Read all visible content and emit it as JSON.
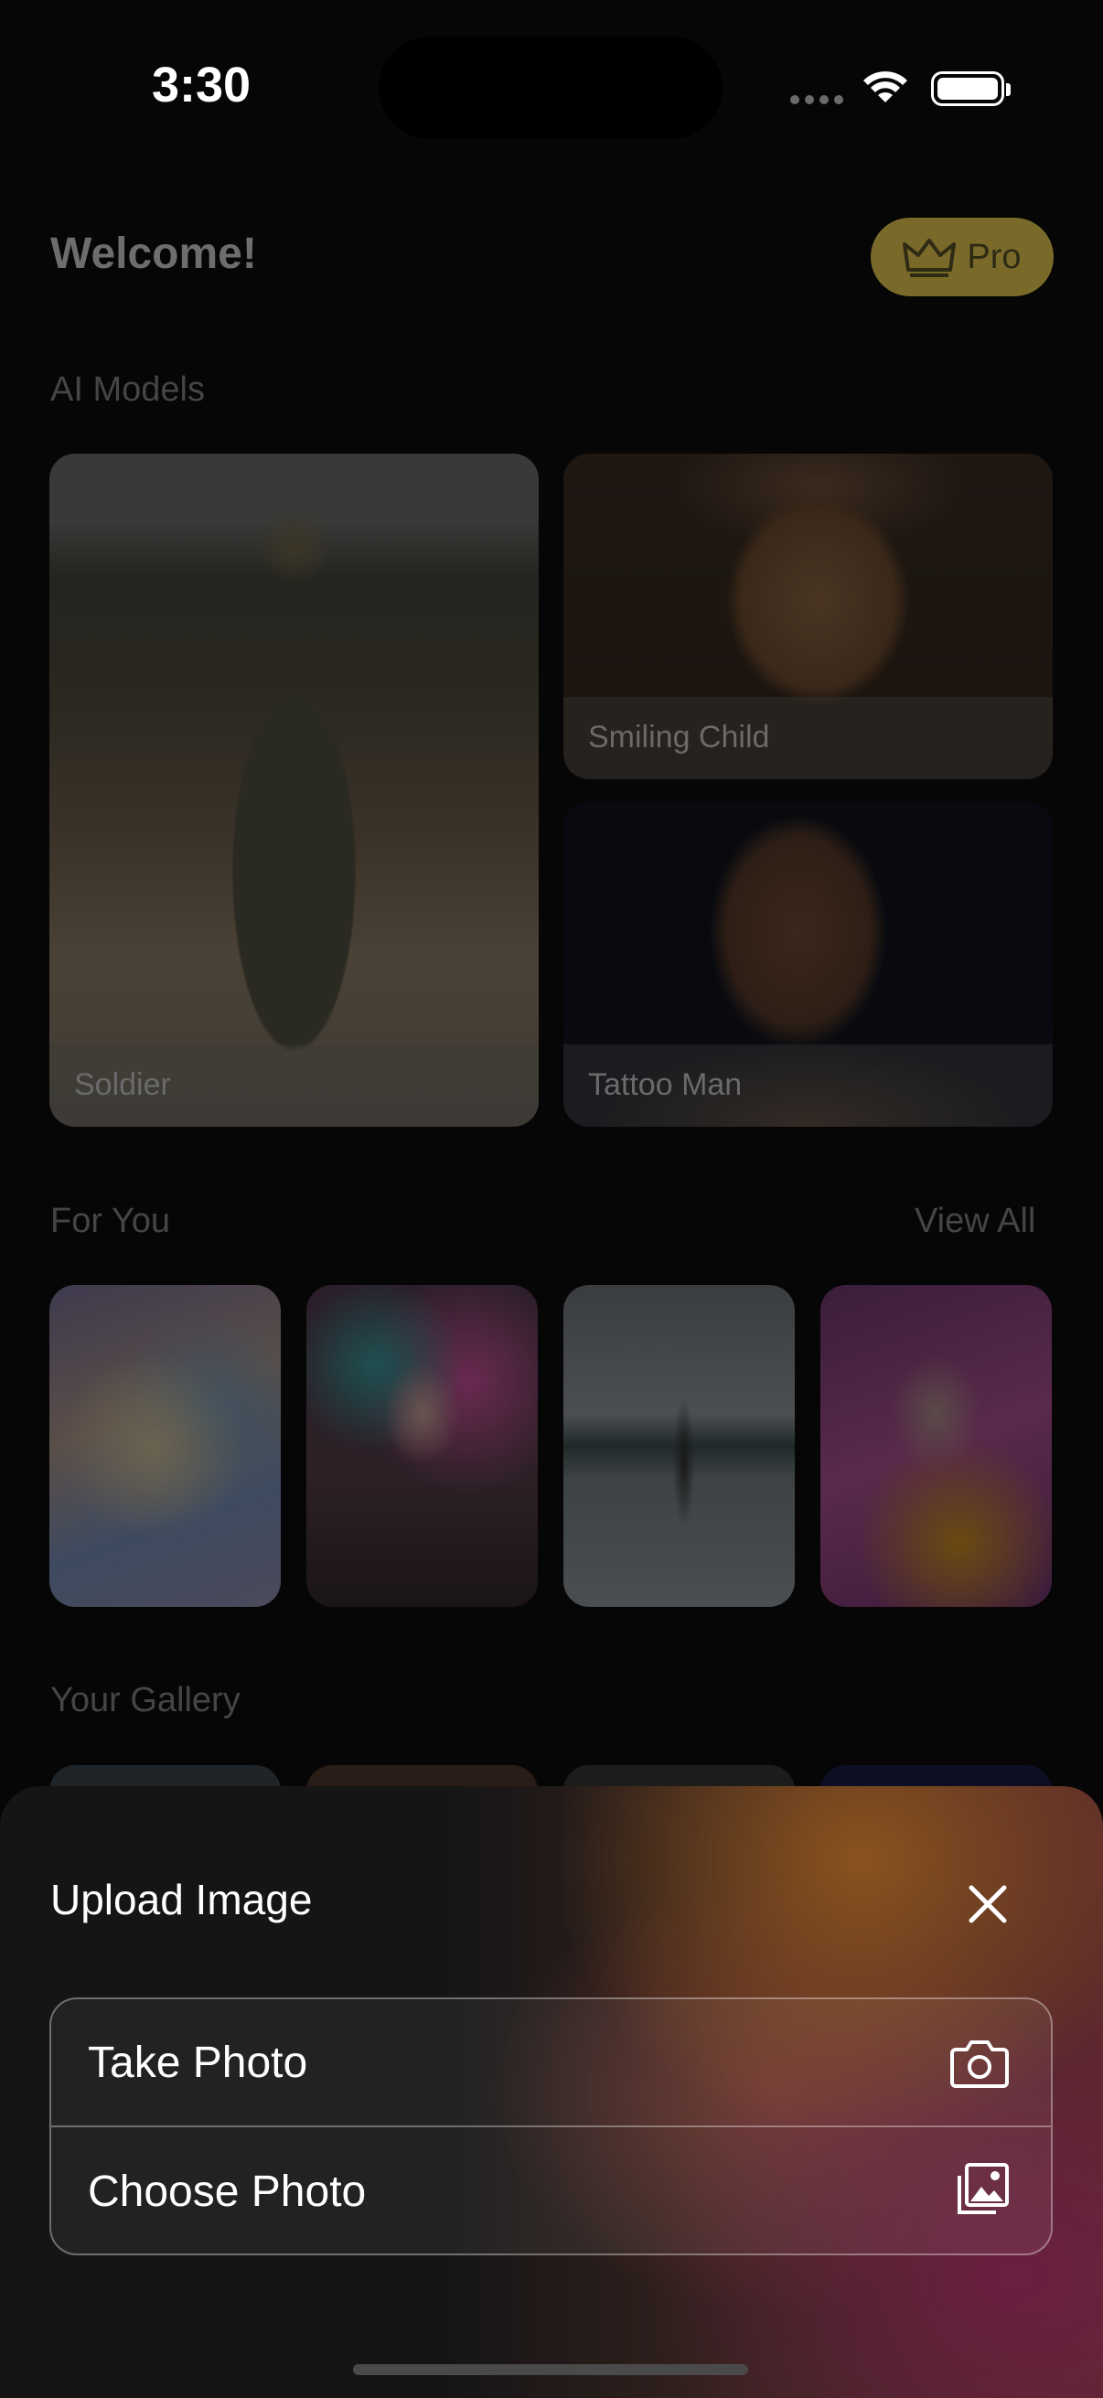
{
  "status_bar": {
    "time": "3:30"
  },
  "header": {
    "title": "Welcome!",
    "pro_label": "Pro"
  },
  "ai_models": {
    "title": "AI Models",
    "cards": [
      {
        "label": "Soldier"
      },
      {
        "label": "Smiling Child"
      },
      {
        "label": "Tattoo Man"
      }
    ]
  },
  "for_you": {
    "title": "For You",
    "view_all": "View All"
  },
  "gallery": {
    "title": "Your Gallery"
  },
  "upload_sheet": {
    "title": "Upload Image",
    "options": [
      {
        "label": "Take Photo",
        "icon": "camera-icon"
      },
      {
        "label": "Choose Photo",
        "icon": "photo-library-icon"
      }
    ]
  },
  "colors": {
    "pro_badge": "#7a6a2a",
    "sheet_accent_orange": "#96561e",
    "sheet_accent_magenta": "#6e1e46"
  }
}
